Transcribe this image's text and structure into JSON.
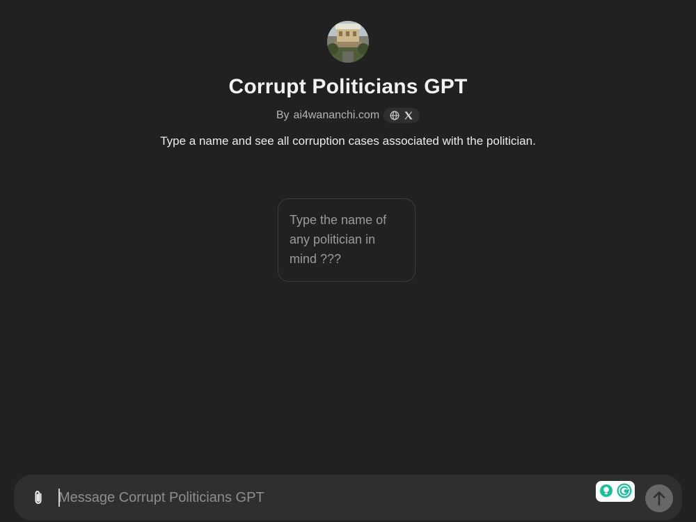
{
  "gpt": {
    "name": "Corrupt Politicians GPT",
    "by_prefix": "By",
    "author": "ai4wananchi.com",
    "description": "Type a name and see all corruption cases associated with the politician.",
    "avatar_icon": "building-photo-avatar",
    "links": [
      "globe-icon",
      "x-logo-icon"
    ]
  },
  "conversation_starters": [
    {
      "text": "Type the name of any politician in mind ???"
    }
  ],
  "composer": {
    "placeholder": "Message Corrupt Politicians GPT",
    "value": "",
    "attach_icon": "paperclip-icon",
    "extension_icon": "grammarly-icon",
    "send_icon": "arrow-up-icon"
  },
  "colors": {
    "background": "#212121",
    "composer_bg": "#2f2f2f",
    "send_button": "#676767",
    "text_primary": "#ececec",
    "text_secondary": "#b4b4b4",
    "grammarly_green": "#15c39a"
  }
}
